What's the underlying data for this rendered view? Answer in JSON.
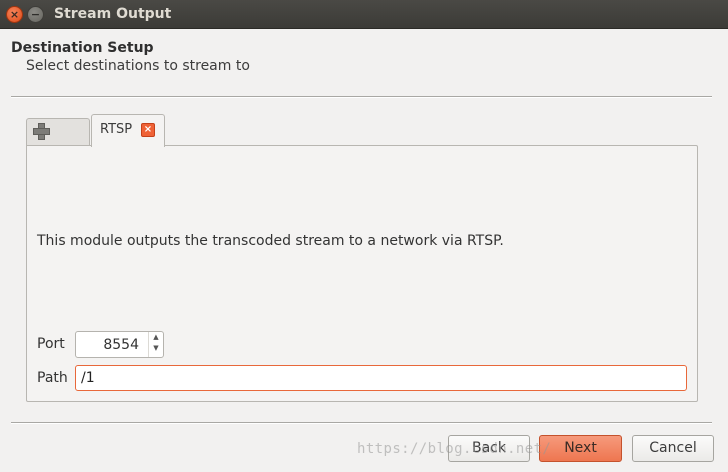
{
  "window": {
    "title": "Stream Output",
    "close_glyph": "×",
    "minimize_glyph": "−"
  },
  "header": {
    "title": "Destination Setup",
    "subtitle": "Select destinations to stream to"
  },
  "tabs": {
    "add_icon": "plus-icon",
    "items": [
      {
        "label": "RTSP",
        "close_glyph": "×",
        "active": true
      }
    ]
  },
  "module": {
    "description": "This module outputs the transcoded stream to a network via RTSP."
  },
  "fields": {
    "port_label": "Port",
    "port_value": "8554",
    "path_label": "Path",
    "path_value": "/1"
  },
  "buttons": {
    "back": "Back",
    "next": "Next",
    "cancel": "Cancel"
  },
  "watermark": "https://blog.csdn.net/",
  "colors": {
    "accent": "#ef6236",
    "titlebar": "#3c3b37"
  }
}
